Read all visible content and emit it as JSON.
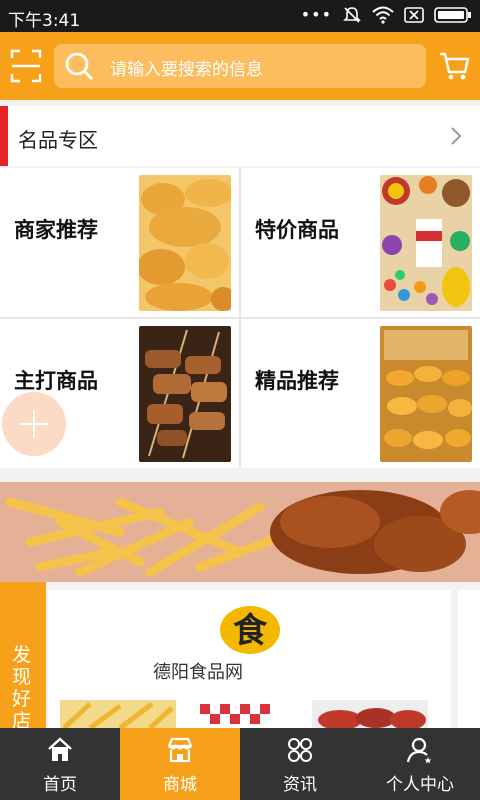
{
  "status_bar": {
    "time": "下午3:41",
    "icons": [
      "more-dots",
      "mute-icon",
      "wifi-icon",
      "sim-icon",
      "battery-icon"
    ]
  },
  "header": {
    "search_placeholder": "请输入要搜索的信息",
    "accent_color": "#f7a11a",
    "icons": [
      "scan-icon",
      "search-icon",
      "cart-icon"
    ]
  },
  "section": {
    "title": "名品专区",
    "accent_color": "#e5242a"
  },
  "categories": [
    {
      "label": "商家推荐",
      "image": "fried-chicken-nuggets"
    },
    {
      "label": "特价商品",
      "image": "sweets-and-drink"
    },
    {
      "label": "主打商品",
      "image": "grilled-skewers"
    },
    {
      "label": "精品推荐",
      "image": "fried-pastries"
    }
  ],
  "banner": {
    "image": "fries-and-fried-chicken"
  },
  "discover": {
    "side_label": "发现好店",
    "shop_name": "德阳食品网",
    "logo_char": "食"
  },
  "bottom_nav": [
    {
      "label": "首页",
      "icon": "home-icon",
      "active": false
    },
    {
      "label": "商城",
      "icon": "store-icon",
      "active": true
    },
    {
      "label": "资讯",
      "icon": "news-icon",
      "active": false
    },
    {
      "label": "个人中心",
      "icon": "user-icon",
      "active": false
    }
  ]
}
